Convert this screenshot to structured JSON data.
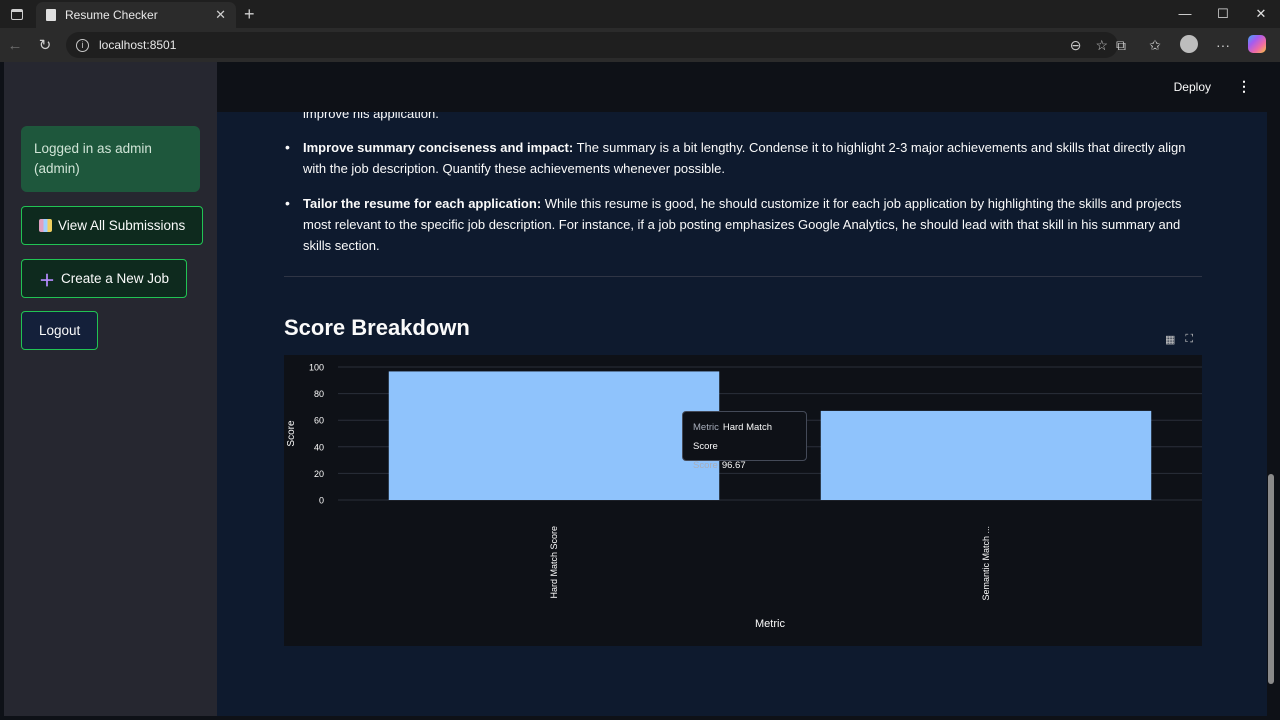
{
  "browser": {
    "tab_title": "Resume Checker",
    "url": "localhost:8501"
  },
  "sidebar": {
    "logged_in_text": "Logged in as admin (admin)",
    "buttons": [
      {
        "label": "View All Submissions",
        "icon": "bar-chart-icon"
      },
      {
        "label": "Create a New Job",
        "icon": "plus-icon"
      },
      {
        "label": "Logout",
        "icon": ""
      }
    ]
  },
  "header": {
    "deploy_label": "Deploy"
  },
  "content": {
    "cutoff_line": "improve his application.",
    "bullets": [
      {
        "bold": "Improve summary conciseness and impact:",
        "text": " The summary is a bit lengthy. Condense it to highlight 2-3 major achievements and skills that directly align with the job description. Quantify these achievements whenever possible."
      },
      {
        "bold": "Tailor the resume for each application:",
        "text": " While this resume is good, he should customize it for each job application by highlighting the skills and projects most relevant to the specific job description. For instance, if a job posting emphasizes Google Analytics, he should lead with that skill in his summary and skills section."
      }
    ],
    "section_title": "Score Breakdown"
  },
  "tooltip": {
    "metric_key": "Metric",
    "metric_value": "Hard Match Score",
    "score_key": "Score",
    "score_value": "96.67"
  },
  "chart_data": {
    "type": "bar",
    "categories": [
      "Hard Match Score",
      "Semantic Match ..."
    ],
    "values": [
      96.67,
      67
    ],
    "xlabel": "Metric",
    "ylabel": "Score",
    "ylim": [
      0,
      100
    ],
    "yticks": [
      0,
      20,
      40,
      60,
      80,
      100
    ],
    "bar_color": "#8fc3fc",
    "grid": true
  }
}
